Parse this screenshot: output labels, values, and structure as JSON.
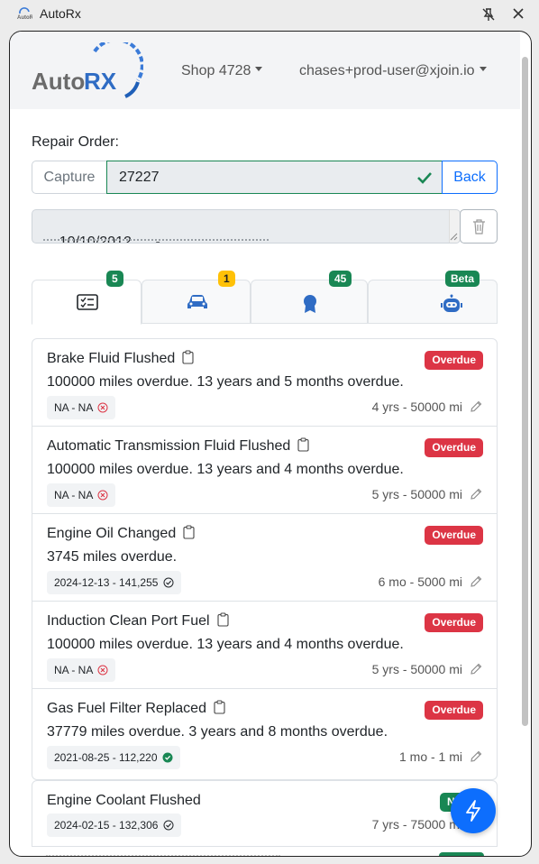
{
  "titlebar": {
    "app_title": "AutoRx"
  },
  "header": {
    "brand_text": "AutoRX",
    "shop_label": "Shop 4728",
    "user_label": "chases+prod-user@xjoin.io"
  },
  "repair_order": {
    "label": "Repair Order:",
    "capture_placeholder": "Capture",
    "value": "27227",
    "back_label": "Back"
  },
  "vehicle_info": "10/10/2012      -",
  "tabs": [
    {
      "icon": "checklist-icon",
      "badge": "5"
    },
    {
      "icon": "car-icon",
      "badge": "1"
    },
    {
      "icon": "award-icon",
      "badge": "45"
    },
    {
      "icon": "robot-icon",
      "badge": "Beta"
    }
  ],
  "services": [
    {
      "title": "Brake Fluid Flushed",
      "desc": "100000 miles overdue. 13 years and 5 months overdue.",
      "status": "Overdue",
      "last": "NA - NA",
      "last_state": "missing",
      "interval": "4 yrs - 50000 mi"
    },
    {
      "title": "Automatic Transmission Fluid Flushed",
      "desc": "100000 miles overdue. 13 years and 4 months overdue.",
      "status": "Overdue",
      "last": "NA - NA",
      "last_state": "missing",
      "interval": "5 yrs - 50000 mi"
    },
    {
      "title": "Engine Oil Changed",
      "desc": "3745 miles overdue.",
      "status": "Overdue",
      "last": "2024-12-13 - 141,255",
      "last_state": "done",
      "interval": "6 mo - 5000 mi"
    },
    {
      "title": "Induction Clean Port Fuel",
      "desc": "100000 miles overdue. 13 years and 4 months overdue.",
      "status": "Overdue",
      "last": "NA - NA",
      "last_state": "missing",
      "interval": "5 yrs - 50000 mi"
    },
    {
      "title": "Gas Fuel Filter Replaced",
      "desc": "37779 miles overdue. 3 years and 8 months overdue.",
      "status": "Overdue",
      "last": "2021-08-25 - 112,220",
      "last_state": "verified",
      "interval": "1 mo - 1 mi"
    }
  ],
  "service_next": {
    "title": "Engine Coolant Flushed",
    "status": "Not D",
    "last": "2024-02-15 - 132,306",
    "interval": "7 yrs - 75000 mi"
  },
  "colors": {
    "primary": "#0d6efd",
    "danger": "#dc3545",
    "success": "#198754",
    "warning": "#ffc107"
  }
}
